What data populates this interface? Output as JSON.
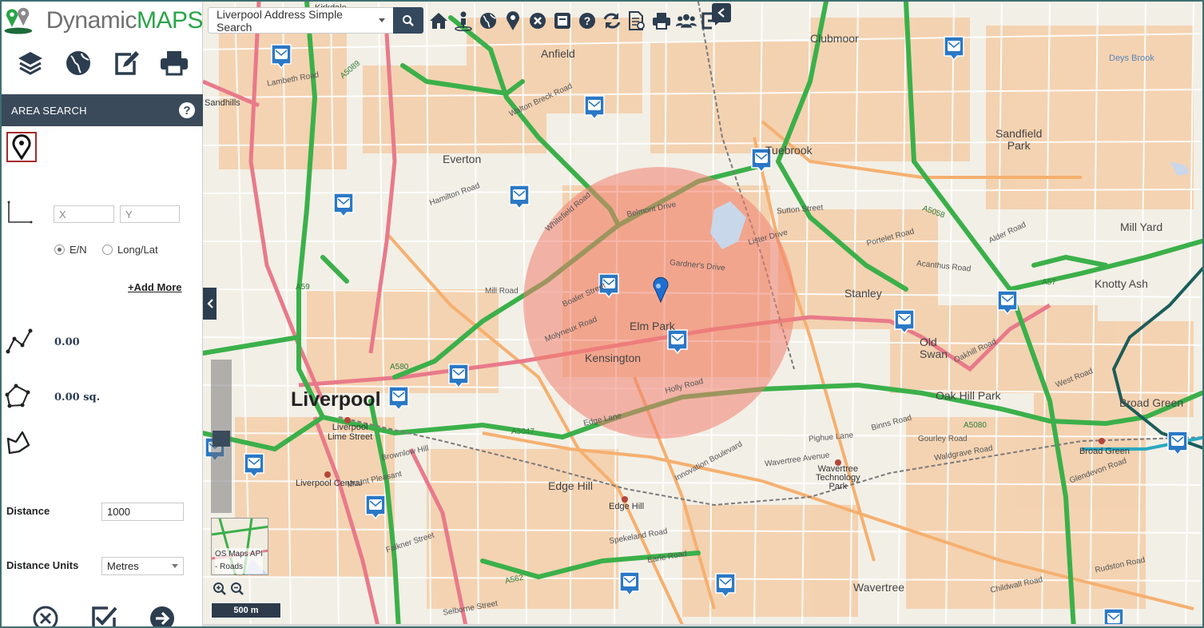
{
  "brand": {
    "word1": "Dynamic",
    "word2": "MAPS"
  },
  "sidebar": {
    "tools": [
      {
        "name": "layers-icon"
      },
      {
        "name": "globe-icon"
      },
      {
        "name": "edit-icon"
      },
      {
        "name": "print-icon"
      }
    ],
    "panel_title": "AREA SEARCH",
    "help_label": "?",
    "x_placeholder": "X",
    "y_placeholder": "Y",
    "radio_en": "E/N",
    "radio_longlat": "Long/Lat",
    "add_more": "+Add More",
    "line_length": "0.00",
    "area_value": "0.00 sq.",
    "distance_label": "Distance",
    "distance_value": "1000",
    "units_label": "Distance Units",
    "units_value": "Metres"
  },
  "search": {
    "selected": "Liverpool Address Simple Search"
  },
  "toolbar_icons": [
    "home-icon",
    "street-view-icon",
    "globe-icon",
    "map-marker-icon",
    "clear-icon",
    "window-icon",
    "help-icon",
    "refresh-icon",
    "report-icon",
    "print-icon",
    "group-icon",
    "logout-icon"
  ],
  "map": {
    "places": {
      "liverpool": "Liverpool",
      "anfield": "Anfield",
      "everton": "Everton",
      "clubmoor": "Clubmoor",
      "tuebrook": "Tuebrook",
      "sandfield": "Sandfield\nPark",
      "millyard": "Mill Yard",
      "knottyash": "Knotty Ash",
      "stanley": "Stanley",
      "oldswan": "Old\nSwan",
      "elmpark": "Elm Park",
      "kensington": "Kensington",
      "oakhill": "Oak Hill Park",
      "broadgreen": "Broad Green",
      "edgehill": "Edge Hill",
      "wavertree": "Wavertree",
      "kirkdale": "Kirkdale",
      "limestreet": "Liverpool\nLime Street",
      "lpcentral": "Liverpool Central",
      "edgehillstn": "Edge Hill",
      "wavtech": "Wavertree\nTechnology\nPark",
      "broadgreenstn": "Broad Green",
      "deysbrook": "Deys Brook",
      "sandhills": "Sandhills"
    },
    "roads": {
      "lambeth": "Lambeth Road",
      "walton_breck": "Walton Breck Road",
      "hamilton": "Hamilton Road",
      "whitefield": "Whitefield Road",
      "belmont": "Belmont Drive",
      "sutton": "Sutton Street",
      "lister": "Lister Drive",
      "gardners": "Gardner's Drive",
      "boaler": "Boaler Street",
      "molyneux": "Molyneux Road",
      "holly": "Holly Road",
      "mill": "Mill Road",
      "brownlow": "Brownlow Hill",
      "mount": "Mount Pleasant",
      "falkner": "Falkner Street",
      "selborne": "Selborne Street",
      "spekeland": "Spekeland Road",
      "earle": "Earle Road",
      "innovation": "Innovation Boulevard",
      "wavertree_ave": "Wavertree Avenue",
      "pighue": "Pighue Lane",
      "binns": "Binns Road",
      "oakhill_rd": "Oakhill Road",
      "west": "West Road",
      "glendevon": "Glendevon Road",
      "waldgrave": "Waldgrave Road",
      "gourley": "Gourley Road",
      "childwall": "Childwall Road",
      "rudston": "Rudston Road",
      "alder": "Alder Road",
      "acanthus": "Acanthus Road",
      "portelet": "Portelet Road",
      "a5089": "A5089",
      "a580": "A580",
      "a5047": "A5047",
      "a5080": "A5080",
      "a5058": "A5058",
      "a57": "A57",
      "a562": "A562",
      "a59": "A59",
      "edge_lane": "Edge Lane"
    },
    "scale": "500 m",
    "basemap_label": "OS Maps API\n- Roads",
    "search_radius_m": 1000,
    "colors": {
      "land": "#f2efe6",
      "green_road": "#3bb04a",
      "pink_road": "#e87a8a",
      "orange_road": "#f5b070",
      "buildings": "#f4c9a0",
      "circle": "#f08070",
      "marker": "#1f6fd1",
      "post_office": "#2b78c5",
      "dark_teal": "#1b5d5a"
    }
  }
}
